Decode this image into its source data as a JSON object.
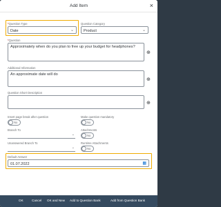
{
  "dialog": {
    "title": "Add Item",
    "close_glyph": "×"
  },
  "form": {
    "question_type": {
      "label": "Question Type",
      "required_mark": "*",
      "value": "Date"
    },
    "question_category": {
      "label": "Question Category",
      "value": "Product"
    },
    "question": {
      "label": "Question",
      "required_mark": "*",
      "value": "Approximately when do you plan to free up your budget for headphones?"
    },
    "additional_information": {
      "label": "Additional Information",
      "value": "An approximate date will do"
    },
    "question_short_description": {
      "label": "Question Short Description",
      "value": ""
    },
    "insert_page_break": {
      "label": "Insert page break after question",
      "state": "No"
    },
    "make_mandatory": {
      "label": "Make question mandatory",
      "state": "No"
    },
    "branch_to": {
      "label": "Branch To",
      "value": ""
    },
    "attachments": {
      "label": "Attachments",
      "state": "No"
    },
    "unanswered_branch_to": {
      "label": "Unanswered Branch To",
      "value": ""
    },
    "runtime_attachments": {
      "label": "Runtime Attachments",
      "state": "No"
    },
    "default_answer": {
      "label": "Default Answer",
      "value": "01.07.2022"
    }
  },
  "footer": {
    "ok": "OK",
    "cancel": "Cancel",
    "ok_and_new": "OK and New",
    "add_to_question_bank": "Add to Question Bank",
    "add_from_question_bank": "Add from Question Bank"
  },
  "icons": {
    "globe": "globe-icon",
    "chevron": "chevron-down-icon",
    "calendar": "calendar-icon"
  },
  "colors": {
    "highlight": "#f0ab00",
    "footer_bg": "#354a5f",
    "required": "#bb0000",
    "accent": "#0a6ed1"
  }
}
